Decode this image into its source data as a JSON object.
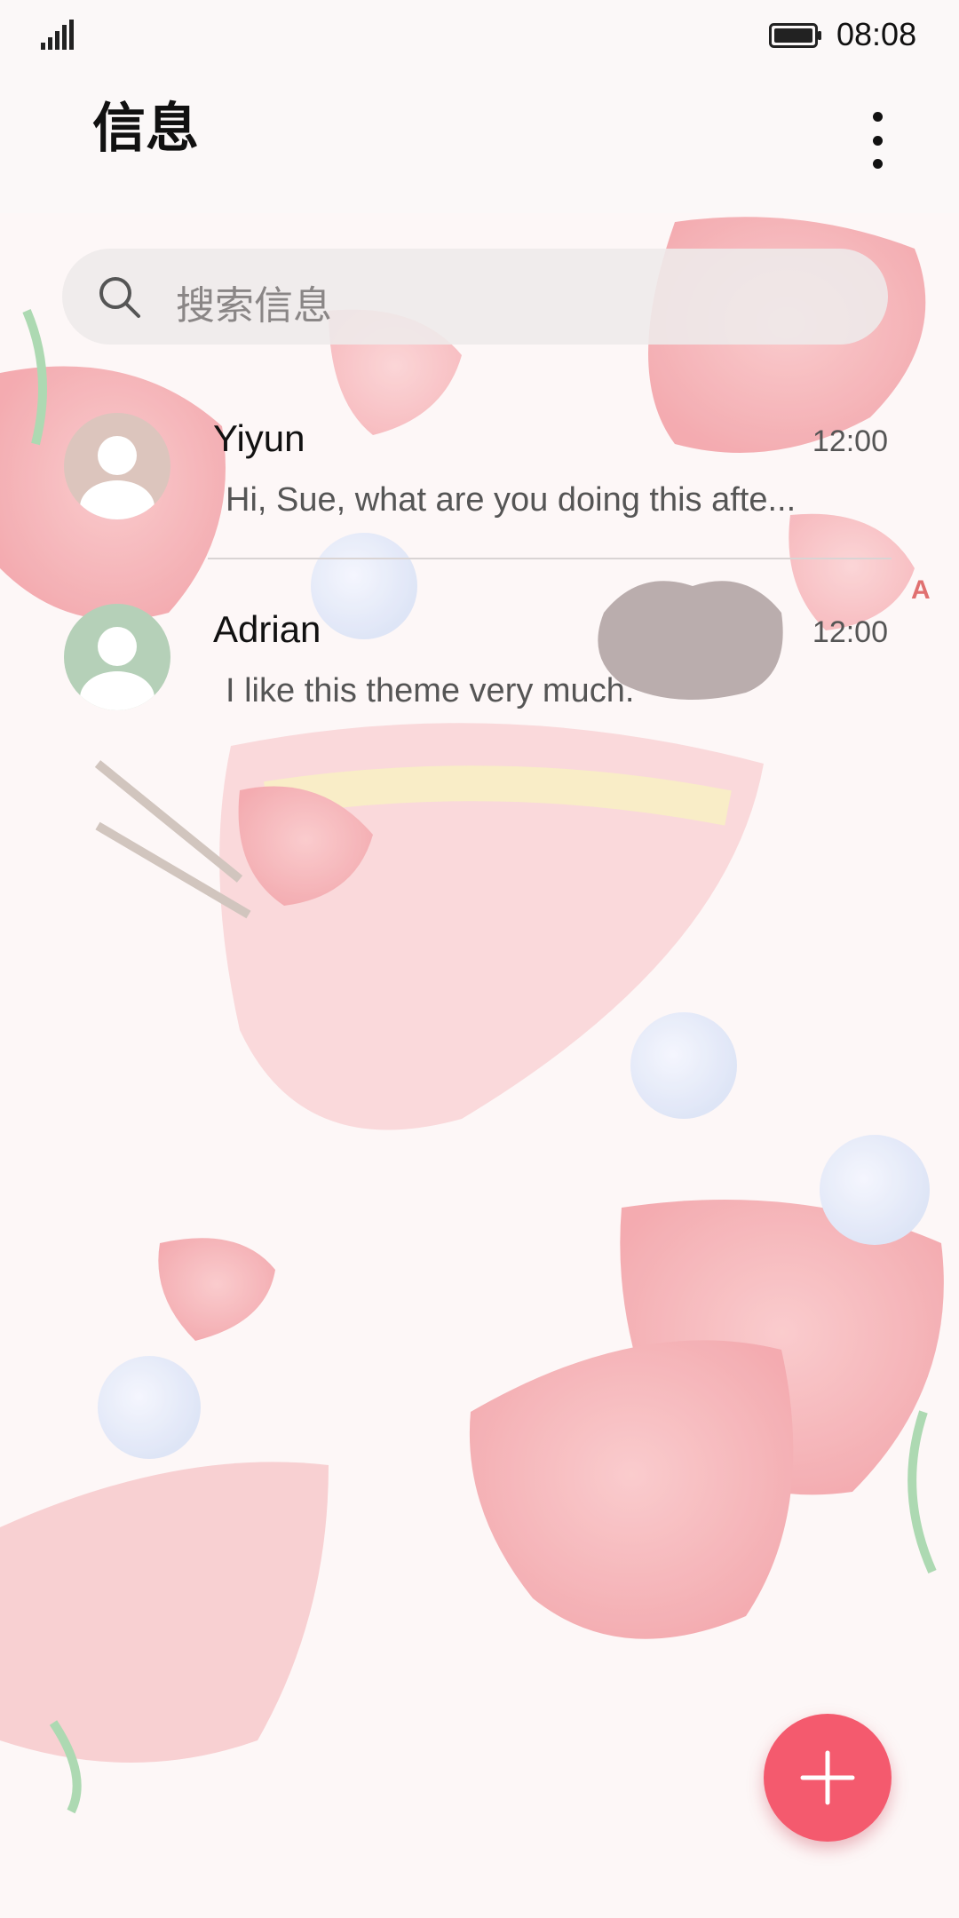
{
  "status_bar": {
    "time": "08:08"
  },
  "header": {
    "title": "信息"
  },
  "search": {
    "placeholder": "搜索信息"
  },
  "conversations": [
    {
      "name": "Yiyun",
      "time": "12:00",
      "preview": "Hi, Sue, what are you doing this afte...",
      "avatar_color": "#dcc5bd"
    },
    {
      "name": "Adrian",
      "time": "12:00",
      "preview": "I like this theme very much.",
      "avatar_color": "#b5d0b8"
    }
  ],
  "index_bar": {
    "letter": "A"
  },
  "colors": {
    "accent": "#f45a6e",
    "background": "#fdf7f7"
  },
  "icons": {
    "signal": "signal-icon",
    "battery": "battery-icon",
    "more": "more-vertical-icon",
    "search": "search-icon",
    "avatar": "person-icon",
    "compose": "plus-icon"
  }
}
